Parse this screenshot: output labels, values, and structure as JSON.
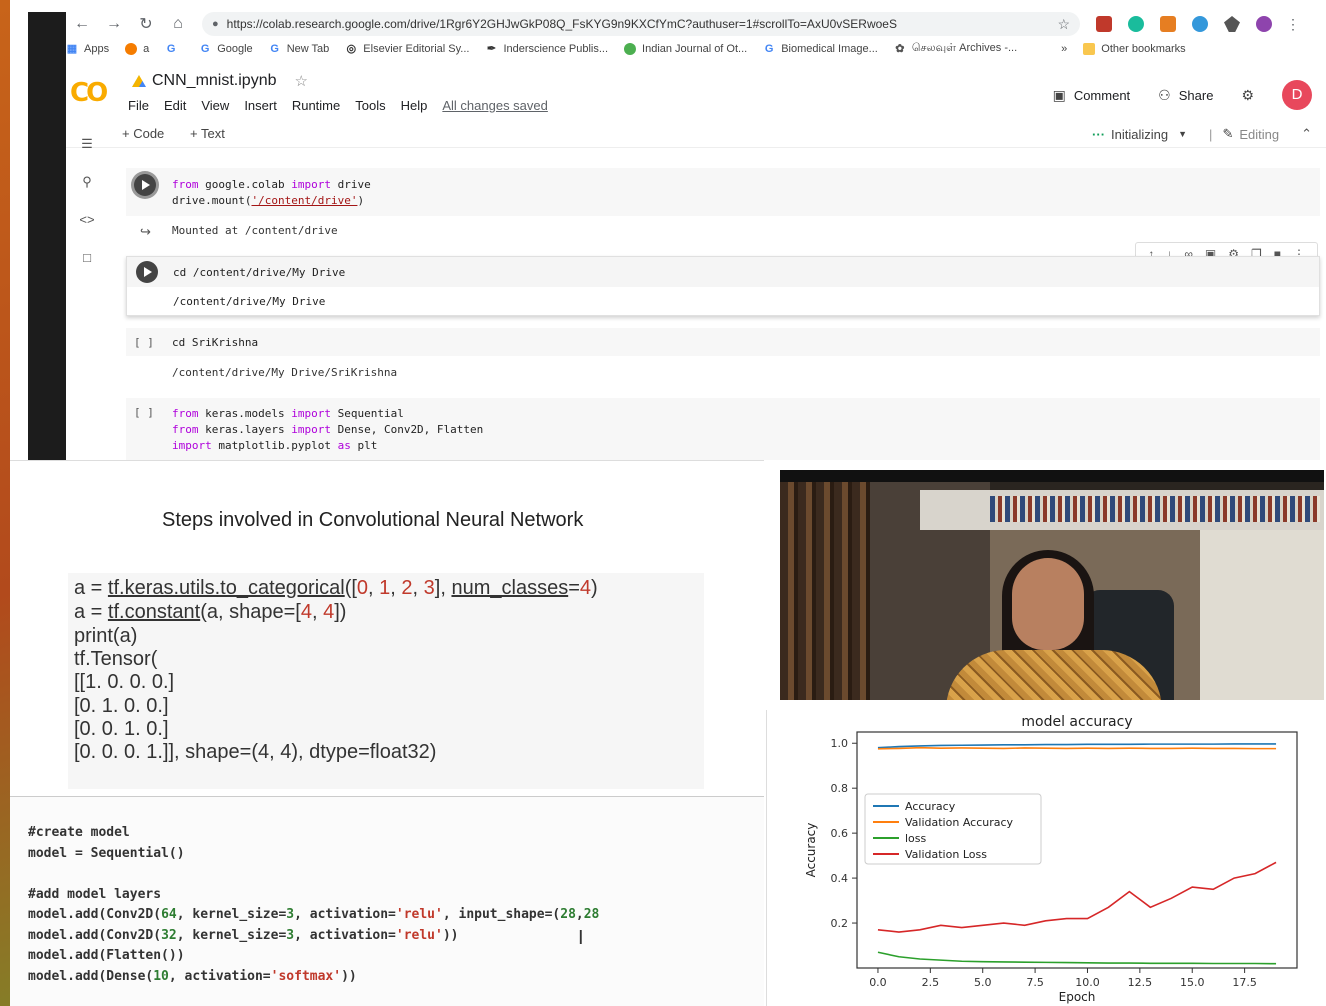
{
  "browser": {
    "url": "https://colab.research.google.com/drive/1Rgr6Y2GHJwGkP08Q_FsKYG9n9KXCfYmC?authuser=1#scrollTo=AxU0vSERwoeS",
    "bookmarks": [
      "Apps",
      "a",
      "Google",
      "New Tab",
      "Elsevier Editorial Sy...",
      "Inderscience Publis...",
      "Indian Journal of Ot...",
      "Biomedical Image...",
      "செலவுள் Archives -...",
      "Other bookmarks"
    ],
    "more_bookmarks": "»"
  },
  "colab": {
    "logo": "CO",
    "title": "CNN_mnist.ipynb",
    "menu": [
      "File",
      "Edit",
      "View",
      "Insert",
      "Runtime",
      "Tools",
      "Help"
    ],
    "saved_status": "All changes saved",
    "comment": "Comment",
    "share": "Share",
    "avatar": "D",
    "add_code": "+ Code",
    "add_text": "+ Text",
    "runtime_status": "Initializing",
    "mode": "Editing"
  },
  "cells": {
    "c1": {
      "line1_kw1": "from",
      "line1_a": " google.colab ",
      "line1_kw2": "import",
      "line1_b": " drive",
      "line2_a": "drive.mount(",
      "line2_str": "'/content/drive'",
      "line2_b": ")"
    },
    "c1_out": "Mounted at /content/drive",
    "c2": "cd /content/drive/My Drive",
    "c2_out": "/content/drive/My Drive",
    "c3_bracket": "[ ]",
    "c3": "cd SriKrishna",
    "c3_out": "/content/drive/My Drive/SriKrishna",
    "c4_bracket": "[ ]",
    "c4_l1_kw": "from",
    "c4_l1_a": " keras.models ",
    "c4_l1_kw2": "import",
    "c4_l1_b": " Sequential",
    "c4_l2_kw": "from",
    "c4_l2_a": " keras.layers ",
    "c4_l2_kw2": "import",
    "c4_l2_b": " Dense, Conv2D, Flatten",
    "c4_l3_kw": "import",
    "c4_l3_a": " matplotlib.pyplot ",
    "c4_l3_kw2": "as",
    "c4_l3_b": " plt"
  },
  "slide": {
    "title": "Steps involved in Convolutional Neural Network",
    "lines": [
      "a = tf.keras.utils.to_categorical([0, 1, 2, 3], num_classes=4)",
      "a = tf.constant(a, shape=[4, 4])",
      "print(a)",
      "tf.Tensor(",
      "[[1. 0. 0. 0.]",
      "[0. 1. 0. 0.]",
      "[0. 0. 1. 0.]",
      "[0. 0. 0. 1.]], shape=(4, 4), dtype=float32)"
    ]
  },
  "code_panel": {
    "c1": "#create model",
    "l1": "model = Sequential()",
    "c2": "#add model layers",
    "l2a": "model.add(Conv2D(",
    "l2n1": "64",
    "l2b": ", kernel_size=",
    "l2n2": "3",
    "l2c": ", activation=",
    "l2s": "'relu'",
    "l2d": ", input_shape=(",
    "l2n3": "28",
    "l2e": ",",
    "l2n4": "28",
    "l3a": "model.add(Conv2D(",
    "l3n1": "32",
    "l3b": ", kernel_size=",
    "l3n2": "3",
    "l3c": ", activation=",
    "l3s": "'relu'",
    "l3d": "))",
    "l4": "model.add(Flatten())",
    "l5a": "model.add(Dense(",
    "l5n": "10",
    "l5b": ", activation=",
    "l5s": "'softmax'",
    "l5c": "))"
  },
  "chart_data": {
    "type": "line",
    "title": "model accuracy",
    "xlabel": "Epoch",
    "ylabel": "Accuracy",
    "x": [
      0,
      1,
      2,
      3,
      4,
      5,
      6,
      7,
      8,
      9,
      10,
      11,
      12,
      13,
      14,
      15,
      16,
      17,
      18,
      19
    ],
    "xlim": [
      -1,
      20
    ],
    "ylim": [
      0,
      1.05
    ],
    "xticks": [
      "0.0",
      "2.5",
      "5.0",
      "7.5",
      "10.0",
      "12.5",
      "15.0",
      "17.5"
    ],
    "xtick_values": [
      0,
      2.5,
      5,
      7.5,
      10,
      12.5,
      15,
      17.5
    ],
    "yticks": [
      "0.2",
      "0.4",
      "0.6",
      "0.8",
      "1.0"
    ],
    "ytick_values": [
      0.2,
      0.4,
      0.6,
      0.8,
      1.0
    ],
    "legend_position": "center-left",
    "series": [
      {
        "name": "Accuracy",
        "color": "#1f77b4",
        "values": [
          0.98,
          0.985,
          0.988,
          0.99,
          0.991,
          0.992,
          0.993,
          0.993,
          0.994,
          0.994,
          0.995,
          0.995,
          0.995,
          0.996,
          0.996,
          0.996,
          0.996,
          0.997,
          0.997,
          0.997
        ]
      },
      {
        "name": "Validation Accuracy",
        "color": "#ff7f0e",
        "values": [
          0.975,
          0.977,
          0.98,
          0.978,
          0.979,
          0.978,
          0.977,
          0.979,
          0.978,
          0.977,
          0.978,
          0.977,
          0.978,
          0.977,
          0.977,
          0.978,
          0.977,
          0.977,
          0.976,
          0.976
        ]
      },
      {
        "name": "loss",
        "color": "#2ca02c",
        "values": [
          0.07,
          0.05,
          0.04,
          0.035,
          0.03,
          0.028,
          0.027,
          0.026,
          0.025,
          0.024,
          0.023,
          0.022,
          0.022,
          0.021,
          0.021,
          0.021,
          0.02,
          0.02,
          0.02,
          0.019
        ]
      },
      {
        "name": "Validation Loss",
        "color": "#d62728",
        "values": [
          0.17,
          0.16,
          0.17,
          0.19,
          0.18,
          0.19,
          0.2,
          0.19,
          0.21,
          0.22,
          0.22,
          0.27,
          0.34,
          0.27,
          0.31,
          0.36,
          0.35,
          0.4,
          0.42,
          0.47
        ]
      }
    ]
  },
  "icons": {
    "back": "←",
    "forward": "→",
    "reload": "↻",
    "home": "⌂",
    "star": "☆",
    "lock": "🔒"
  }
}
